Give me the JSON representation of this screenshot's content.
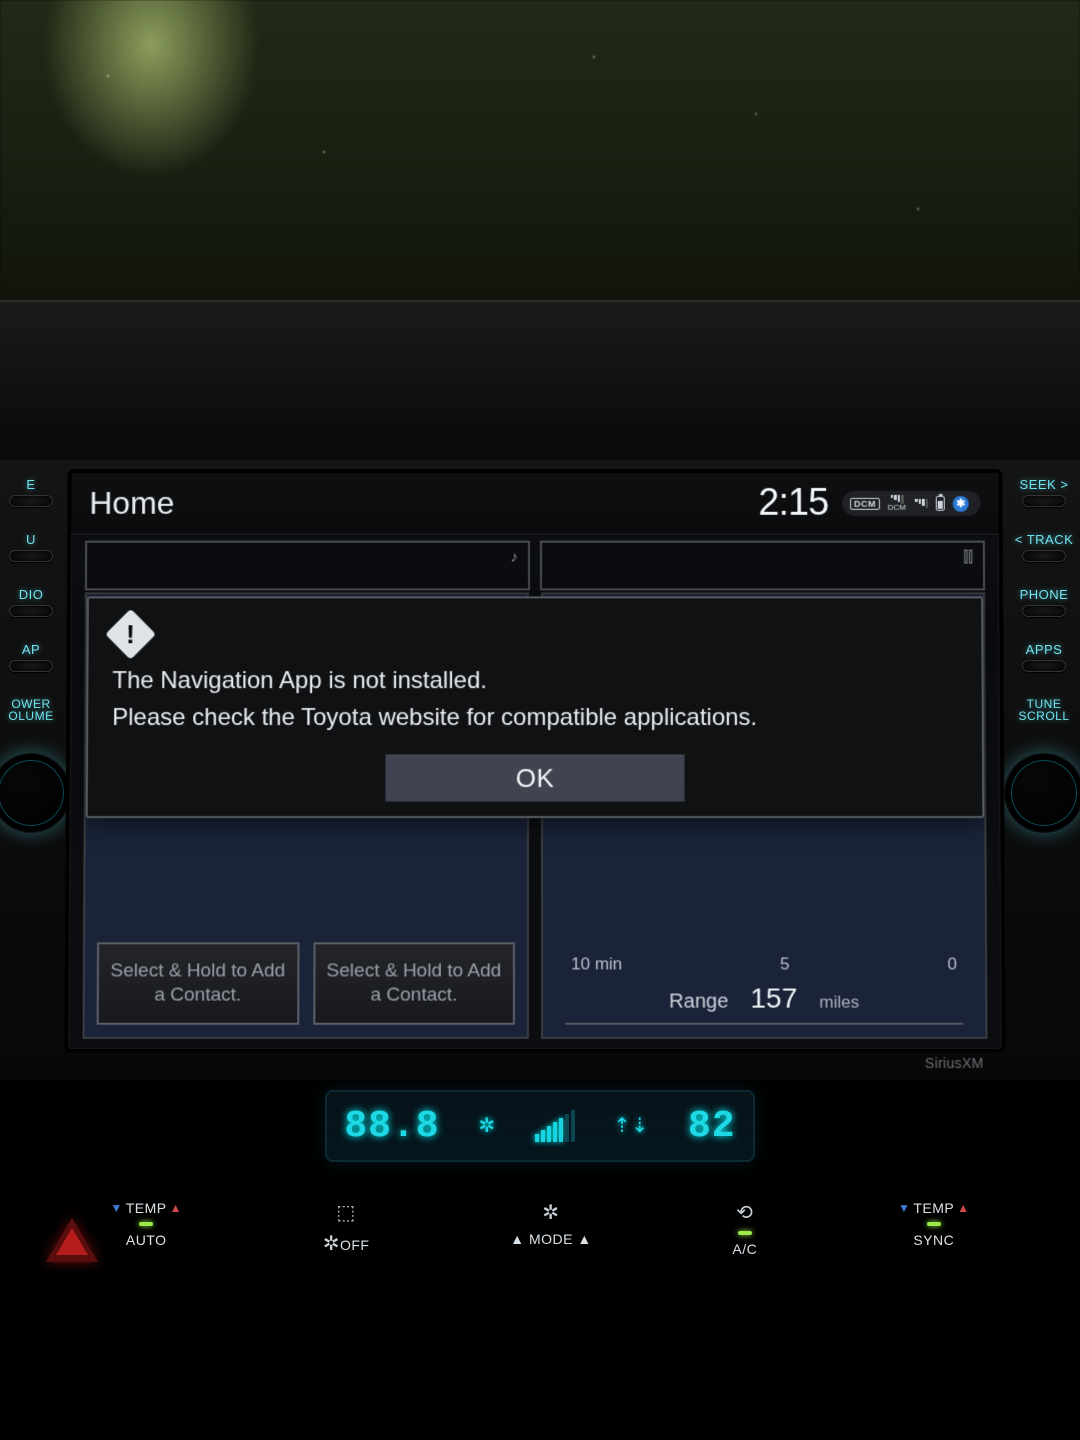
{
  "statusbar": {
    "title": "Home",
    "time": "2:15",
    "dcm_label": "DCM",
    "dcm_sub": "DCM"
  },
  "panels": {
    "music_icon": "♪",
    "chart_icon": "⫿⫿"
  },
  "contacts": {
    "card1": "Select & Hold to\nAdd a Contact.",
    "card2": "Select & Hold to\nAdd a Contact."
  },
  "fuel": {
    "tick1": "10 min",
    "tick2": "5",
    "tick3": "0",
    "range_label": "Range",
    "range_value": "157",
    "range_unit": "miles"
  },
  "dialog": {
    "message": "The Navigation App is not installed.\nPlease check the Toyota website for compatible applications.",
    "ok_label": "OK"
  },
  "branding": {
    "siriusxm": "SiriusXM"
  },
  "hw_left": {
    "b1": "E",
    "b2": "U",
    "b3": "DIO",
    "b4": "AP",
    "b5": "OWER\nOLUME"
  },
  "hw_right": {
    "b1": "SEEK >",
    "b2": "< TRACK",
    "b3": "PHONE",
    "b4": "APPS",
    "b5": "TUNE\nSCROLL"
  },
  "climate": {
    "left_temp": "88.8",
    "right_temp": "82",
    "temp_label_l": "TEMP",
    "auto": "AUTO",
    "off": "OFF",
    "mode": "MODE",
    "ac": "A/C",
    "sync": "SYNC",
    "temp_label_r": "TEMP"
  }
}
